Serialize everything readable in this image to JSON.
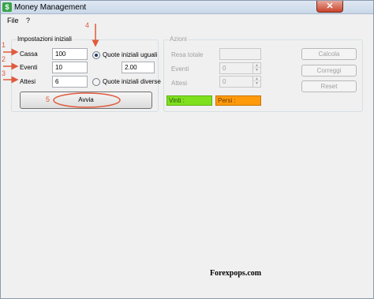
{
  "window": {
    "title": "Money Management",
    "close_glyph": "✕"
  },
  "menu": {
    "file": "File",
    "help": "?"
  },
  "settings": {
    "group_title": "Impostazioni iniziali",
    "cassa_label": "Cassa",
    "cassa_value": "100",
    "eventi_label": "Eventi",
    "eventi_value": "10",
    "attesi_label": "Attesi",
    "attesi_value": "6",
    "radio_equal_label": "Quote iniziali uguali",
    "radio_different_label": "Quote iniziali diverse",
    "radio_selected": "equal",
    "quote_value": "2.00",
    "start_button": "Avvia"
  },
  "actions": {
    "group_title": "Azioni",
    "resa_label": "Resa totale",
    "resa_value": "",
    "eventi_label": "Eventi",
    "eventi_value": "0",
    "attesi_label": "Attesi",
    "attesi_value": "0",
    "calcola_button": "Calcola",
    "correggi_button": "Correggi",
    "reset_button": "Reset",
    "vinti_label": "Vinti :",
    "persi_label": "Persi :",
    "vinti_color": "#7fe01e",
    "persi_color": "#ff9a0a"
  },
  "annotations": {
    "n1": "1",
    "n2": "2",
    "n3": "3",
    "n4": "4",
    "n5": "5",
    "color": "#e05a3c"
  },
  "watermark": "Forexpops.com"
}
